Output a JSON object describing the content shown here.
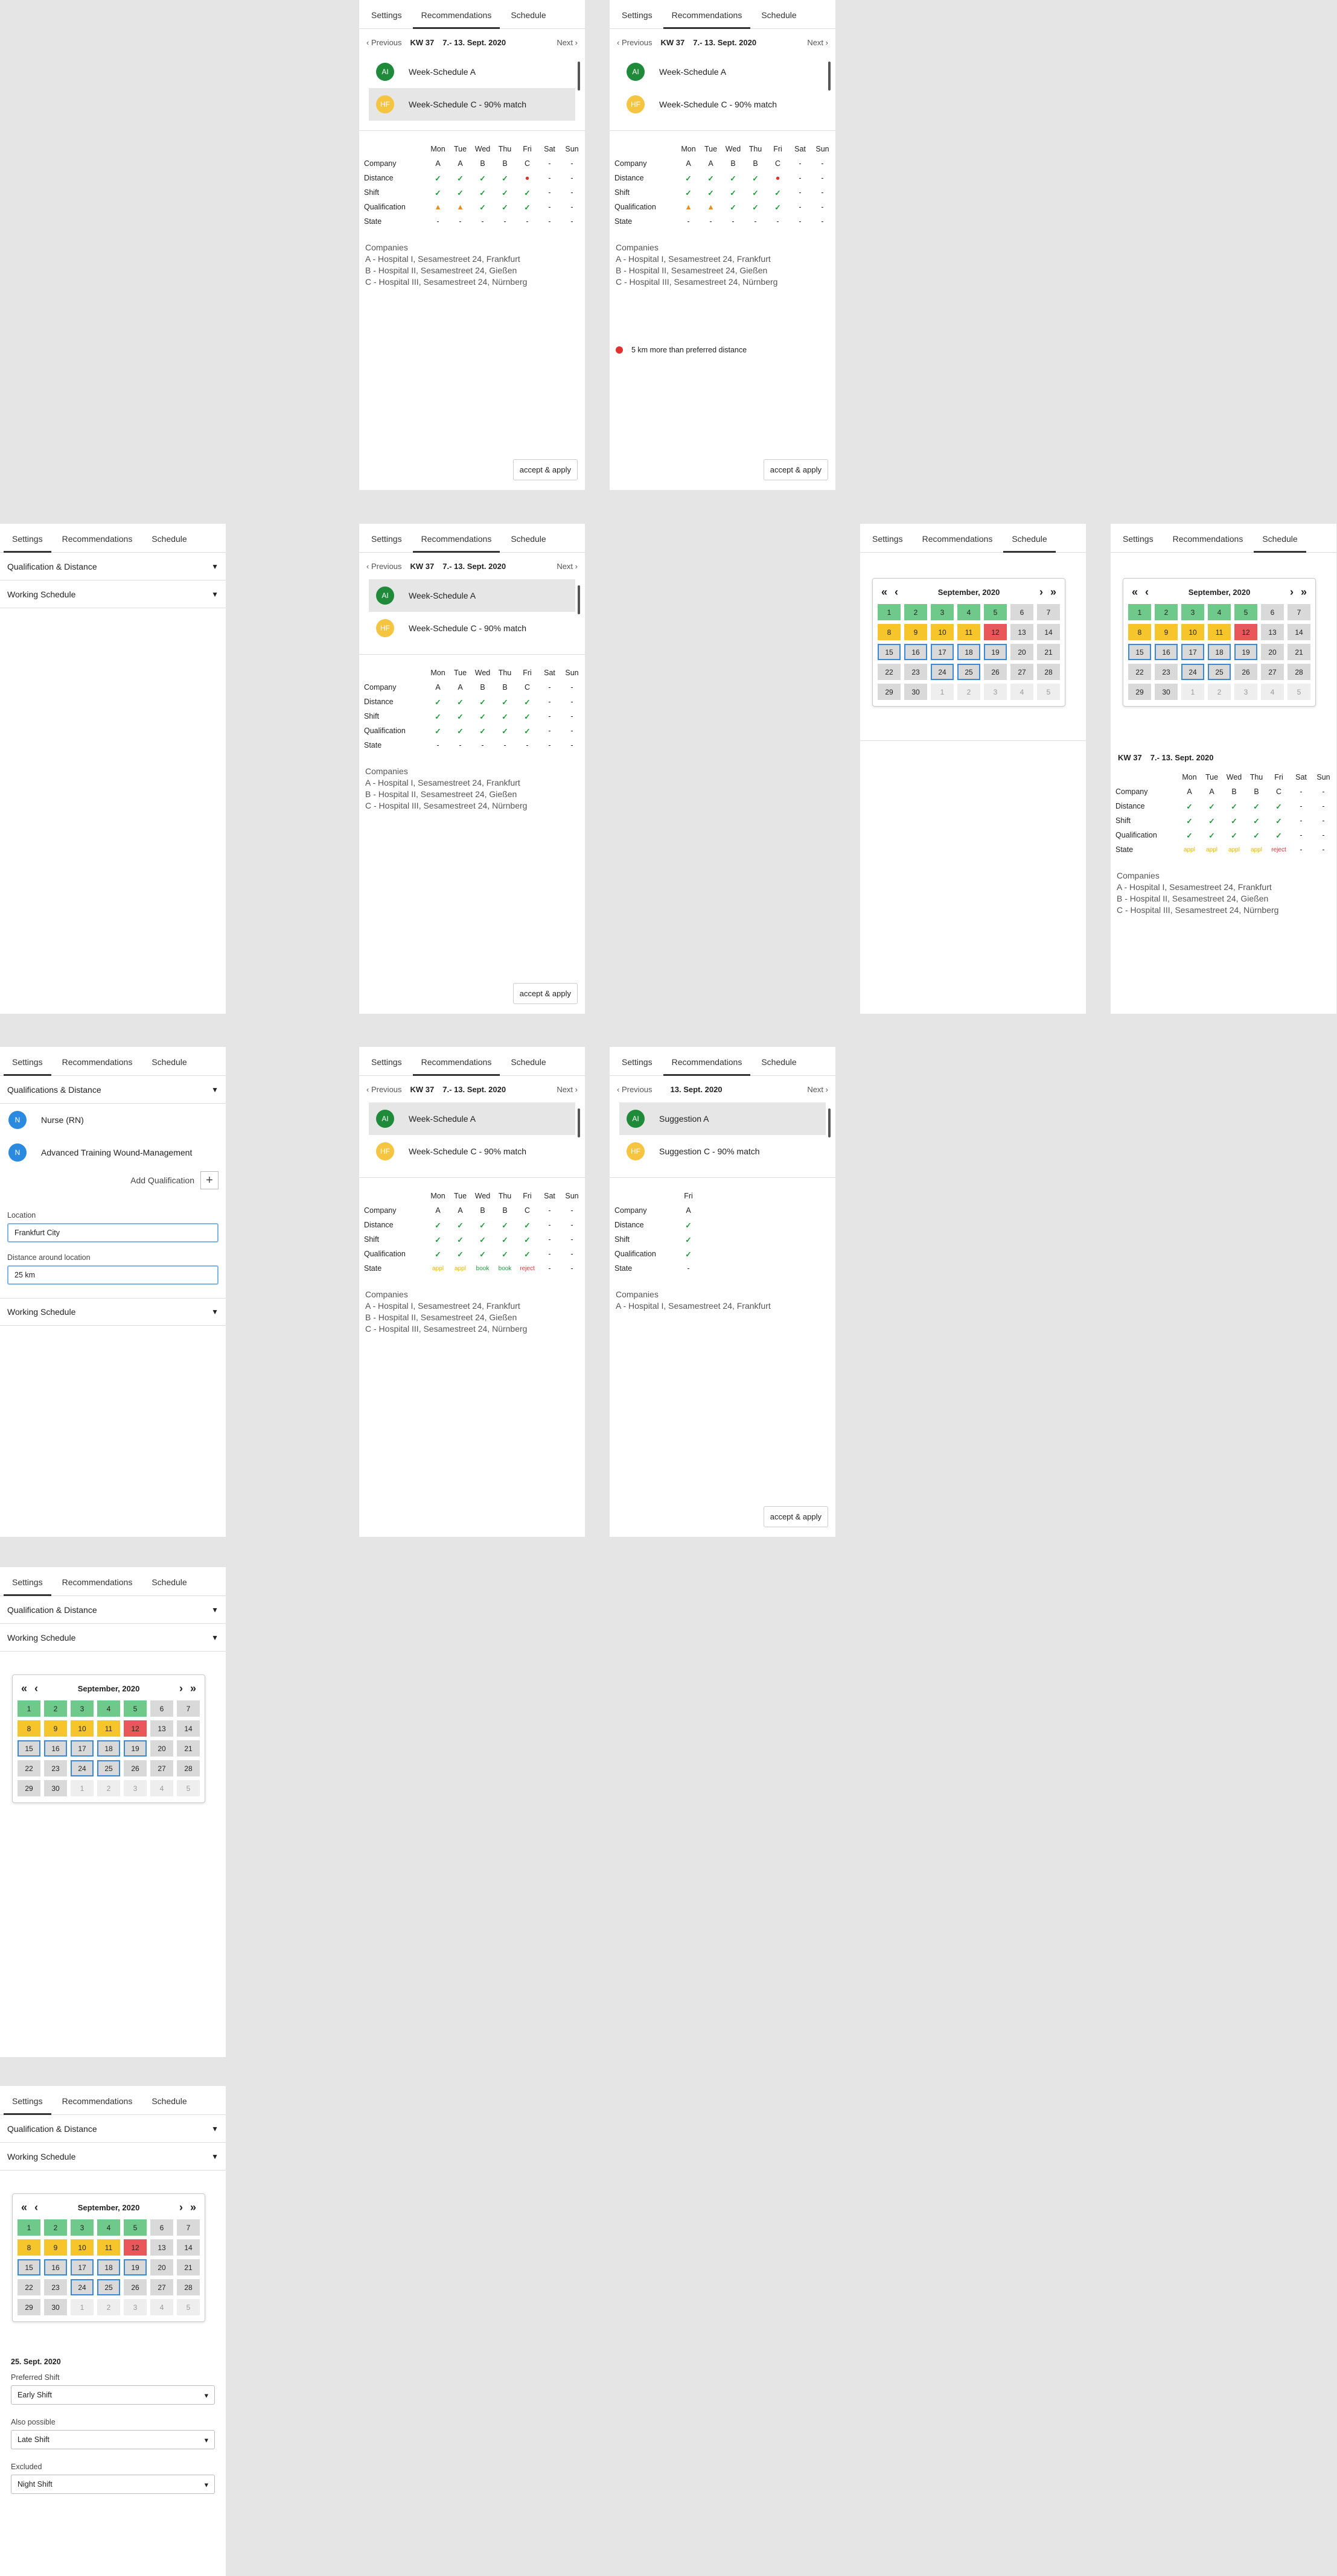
{
  "tabs": {
    "settings": "Settings",
    "recommendations": "Recommendations",
    "schedule": "Schedule"
  },
  "nav": {
    "prev": "Previous",
    "next": "Next",
    "week": "KW 37",
    "range": "7.- 13. Sept. 2020",
    "day": "13. Sept. 2020"
  },
  "suggestions": {
    "a": {
      "initials": "AI",
      "label": "Week-Schedule A"
    },
    "c": {
      "initials": "HF",
      "label": "Week-Schedule C - 90% match"
    },
    "sa": {
      "initials": "AI",
      "label": "Suggestion A"
    },
    "sc": {
      "initials": "HF",
      "label": "Suggestion C - 90% match"
    }
  },
  "days": [
    "Mon",
    "Tue",
    "Wed",
    "Thu",
    "Fri",
    "Sat",
    "Sun"
  ],
  "rows": [
    "Company",
    "Distance",
    "Shift",
    "Qualification",
    "State"
  ],
  "company_values": [
    "A",
    "A",
    "B",
    "B",
    "C",
    "-",
    "-"
  ],
  "companies": {
    "title": "Companies",
    "a": "A - Hospital I, Sesamestreet 24, Frankfurt",
    "b": "B - Hospital II, Sesamestreet 24, Gießen",
    "c": "C - Hospital III, Sesamestreet 24, Nürnberg"
  },
  "accept": "accept & apply",
  "note": "5 km more than preferred distance",
  "states": {
    "appl": "appl",
    "book": "book",
    "reject": "reject"
  },
  "settings": {
    "qd": "Qualification & Distance",
    "qd2": "Qualifications & Distance",
    "ws": "Working Schedule",
    "nurse": "Nurse (RN)",
    "wound": "Advanced Training Wound-Management",
    "n": "N",
    "addq": "Add Qualification",
    "location": "Location",
    "location_value": "Frankfurt City",
    "distance": "Distance around location",
    "distance_value": "25 km"
  },
  "calendar": {
    "month": "September, 2020"
  },
  "shift": {
    "date": "25. Sept. 2020",
    "preferred": "Preferred Shift",
    "preferred_value": "Early Shift",
    "also": "Also possible",
    "also_value": "Late Shift",
    "excluded": "Excluded",
    "excluded_value": "Night Shift"
  },
  "icons": {
    "check": "✓",
    "warn": "▲",
    "error": "●",
    "dash": "-"
  }
}
